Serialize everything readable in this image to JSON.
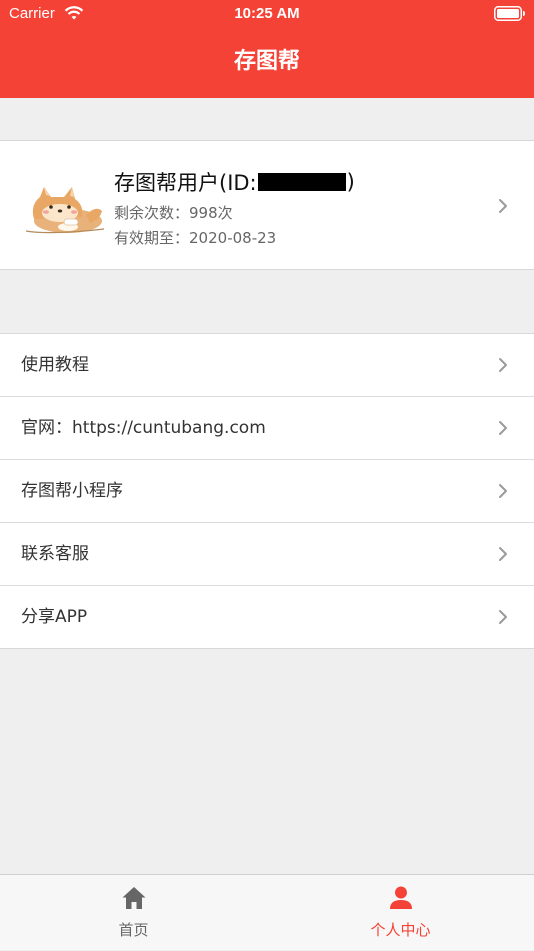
{
  "status_bar": {
    "carrier": "Carrier",
    "time": "10:25 AM"
  },
  "header": {
    "title": "存图帮"
  },
  "profile": {
    "name_prefix": "存图帮用户(ID:",
    "name_suffix": ")",
    "remaining_label": "剩余次数：",
    "remaining_value": "998次",
    "expiry_label": "有效期至：",
    "expiry_value": "2020-08-23"
  },
  "menu": {
    "items": [
      {
        "label": "使用教程"
      },
      {
        "label": "官网：https://cuntubang.com"
      },
      {
        "label": "存图帮小程序"
      },
      {
        "label": "联系客服"
      },
      {
        "label": "分享APP"
      }
    ]
  },
  "tabs": [
    {
      "label": "首页",
      "icon": "home-icon",
      "active": false
    },
    {
      "label": "个人中心",
      "icon": "user-icon",
      "active": true
    }
  ],
  "colors": {
    "accent": "#f44336",
    "background": "#efefef",
    "tab_inactive": "#666666"
  }
}
